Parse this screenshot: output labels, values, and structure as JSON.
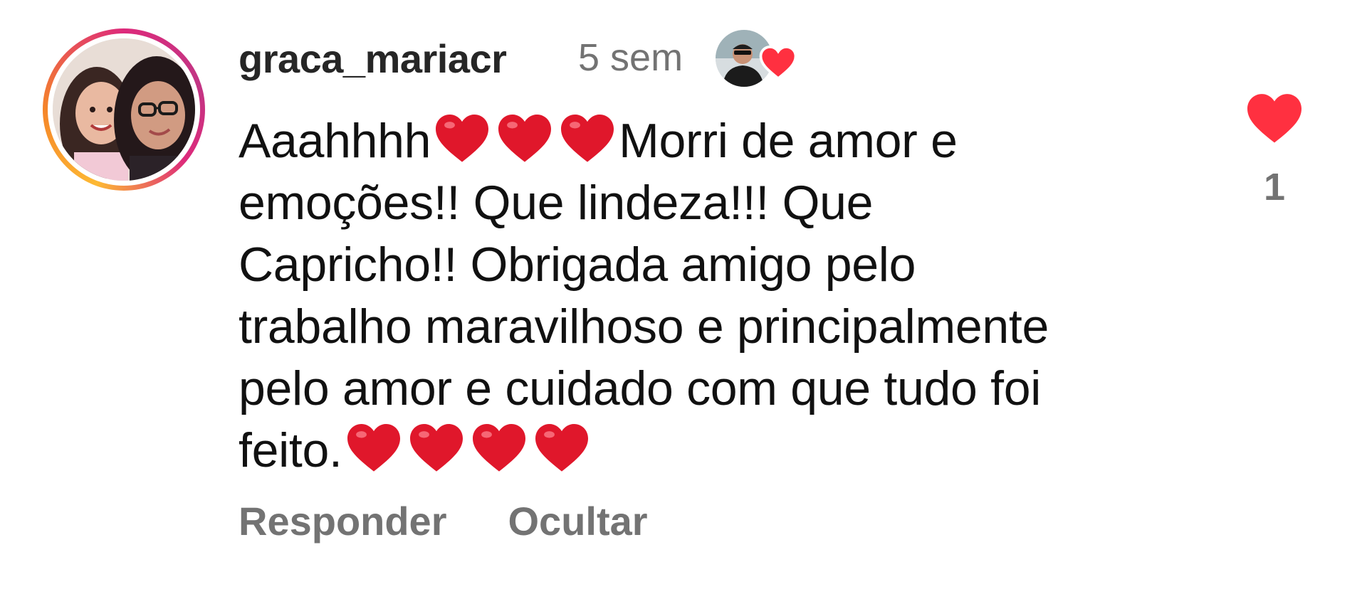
{
  "comment": {
    "username": "graca_mariacr",
    "timestamp": "5 sem",
    "text_segments": [
      "Aaahhhh",
      "Morri de amor e\nemoções!! Que lindeza!!! Que\nCapricho!! Obrigada amigo pelo\ntrabalho maravilhoso e principalmente\npelo amor e cuidado com que tudo foi\nfeito."
    ],
    "heart_emoji_color": "#e0172b",
    "like_count": "1",
    "like_color": "#ff3040"
  },
  "actions": {
    "reply_label": "Responder",
    "hide_label": "Ocultar"
  },
  "icons": {
    "avatar": "profile-photo",
    "liked_by": "creator-liked-heart-icon",
    "like": "heart-filled-icon"
  },
  "colors": {
    "story_ring": [
      "#fdb934",
      "#f58529",
      "#dd2a7b",
      "#c13584"
    ],
    "secondary_text": "#737373",
    "primary_text": "#111111"
  }
}
